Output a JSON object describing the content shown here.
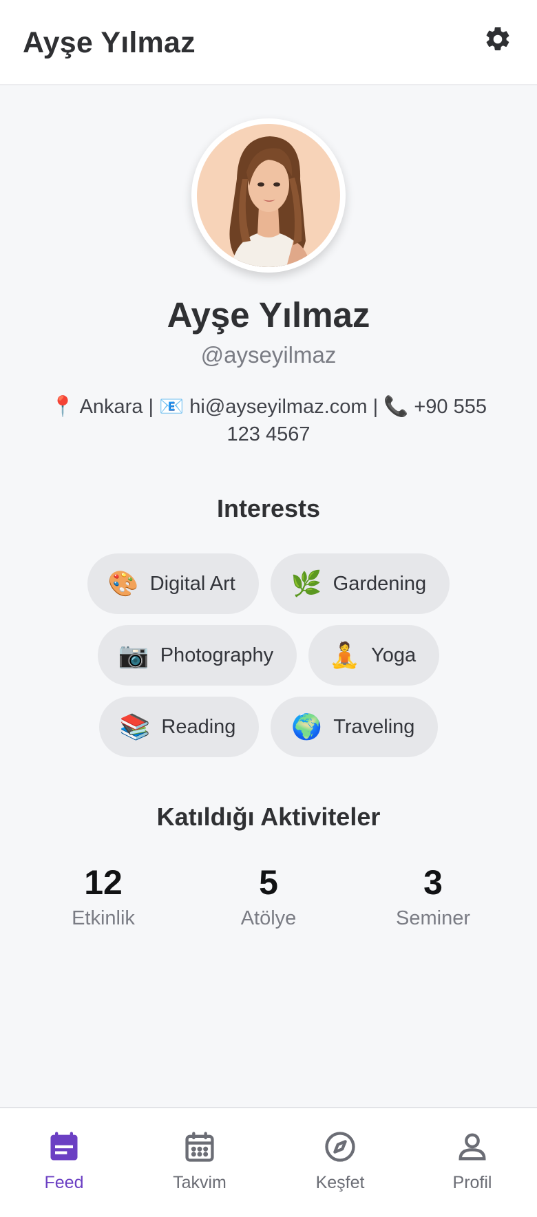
{
  "header": {
    "title": "Ayşe Yılmaz"
  },
  "profile": {
    "name": "Ayşe Yılmaz",
    "handle": "@ayseyilmaz",
    "contact": "📍 Ankara | 📧 hi@ayseyilmaz.com | 📞 +90 555 123 4567"
  },
  "interests": {
    "title": "Interests",
    "items": [
      {
        "emoji": "🎨",
        "label": "Digital Art"
      },
      {
        "emoji": "🌿",
        "label": "Gardening"
      },
      {
        "emoji": "📷",
        "label": "Photography"
      },
      {
        "emoji": "🧘",
        "label": "Yoga"
      },
      {
        "emoji": "📚",
        "label": "Reading"
      },
      {
        "emoji": "🌍",
        "label": "Traveling"
      }
    ]
  },
  "activities": {
    "title": "Katıldığı Aktiviteler",
    "stats": [
      {
        "value": "12",
        "label": "Etkinlik"
      },
      {
        "value": "5",
        "label": "Atölye"
      },
      {
        "value": "3",
        "label": "Seminer"
      }
    ]
  },
  "nav": {
    "items": [
      {
        "label": "Feed",
        "icon": "feed-icon",
        "active": true
      },
      {
        "label": "Takvim",
        "icon": "calendar-icon",
        "active": false
      },
      {
        "label": "Keşfet",
        "icon": "compass-icon",
        "active": false
      },
      {
        "label": "Profil",
        "icon": "user-icon",
        "active": false
      }
    ]
  },
  "colors": {
    "accent": "#6b3fc3",
    "background": "#f6f7f9",
    "chip": "#e6e7ea"
  }
}
